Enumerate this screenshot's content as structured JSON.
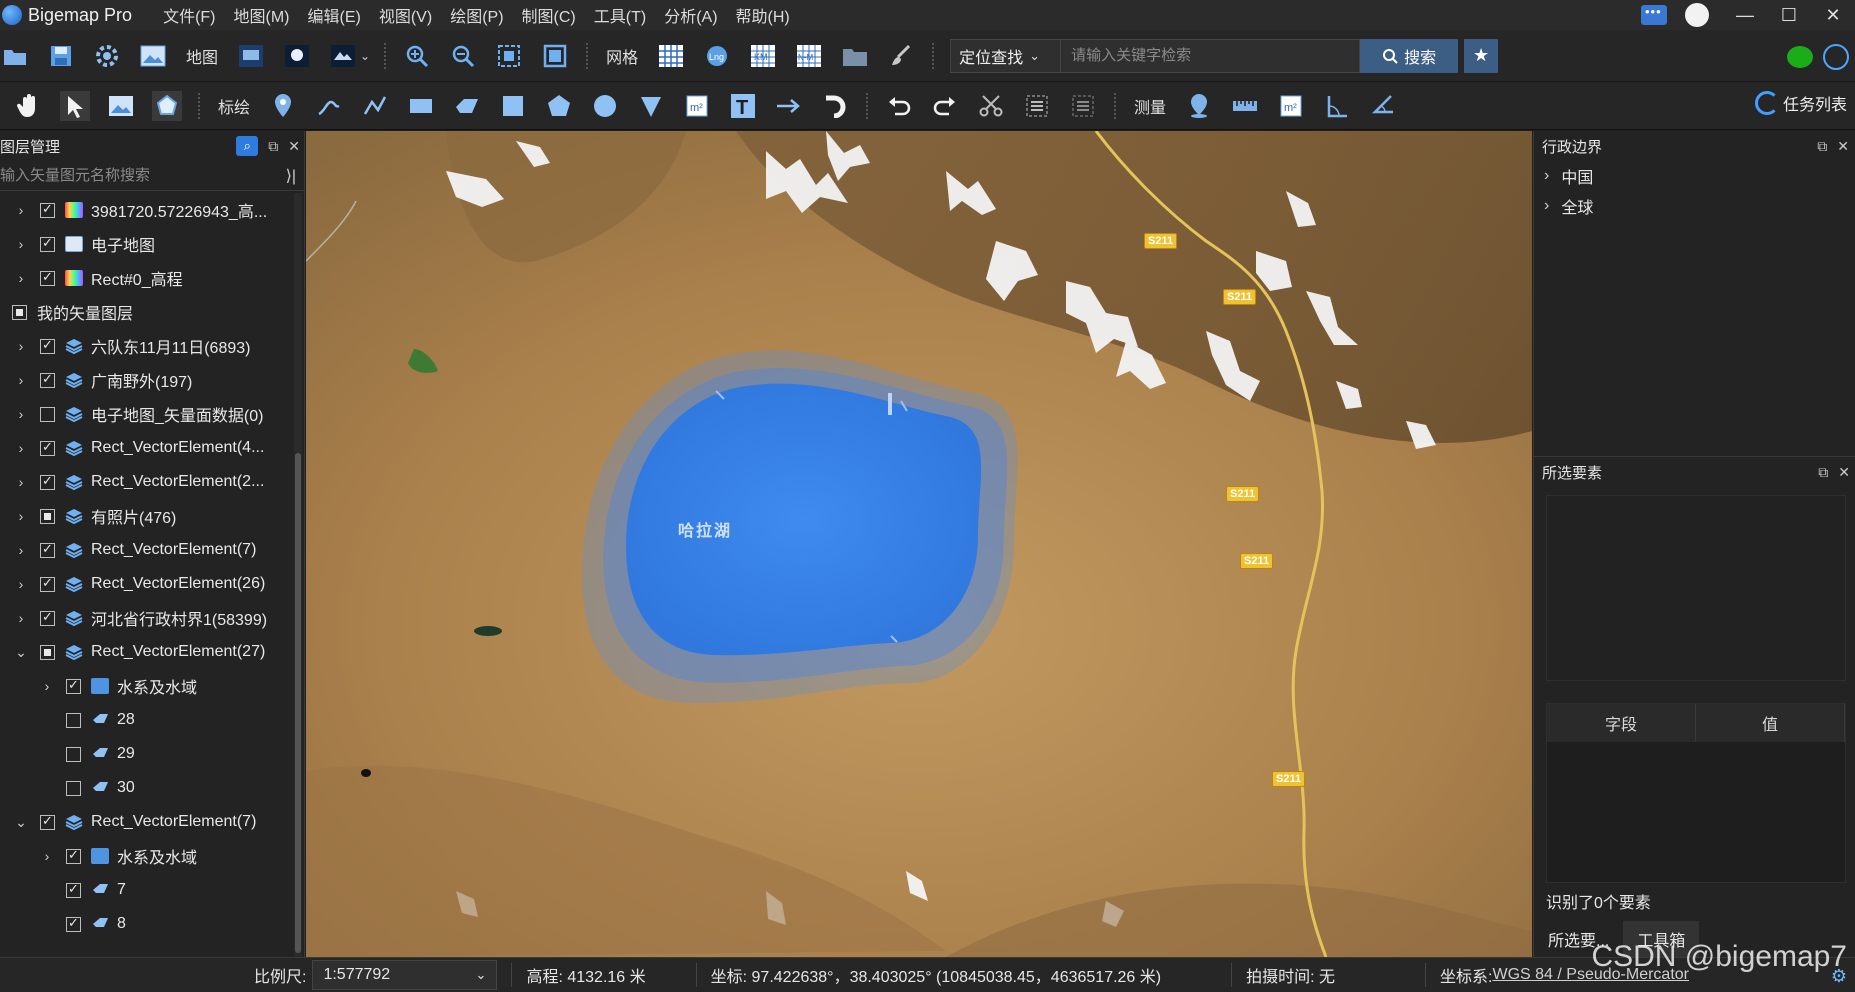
{
  "app": {
    "title": "Bigemap Pro"
  },
  "menu": [
    "文件(F)",
    "地图(M)",
    "编辑(E)",
    "视图(V)",
    "绘图(P)",
    "制图(C)",
    "工具(T)",
    "分析(A)",
    "帮助(H)"
  ],
  "toolbar1": {
    "map_label": "地图",
    "grid_label": "网格",
    "search_mode": "定位查找",
    "search_placeholder": "请输入关键字检索",
    "search_button": "搜索",
    "icon_lng": "Lng",
    "icon_km": "KM",
    "icon_nm": "N-M"
  },
  "toolbar2": {
    "draw_label": "标绘",
    "measure_label": "测量",
    "text_tool": "T",
    "area_unit": "m²",
    "task_list": "任务列表"
  },
  "left_panel": {
    "title": "图层管理",
    "search_placeholder": "输入矢量图元名称搜索",
    "rows": [
      {
        "label": "3981720.57226943_高...",
        "chev": "›",
        "check": "checked",
        "icon": "raster",
        "indent": 0
      },
      {
        "label": "电子地图",
        "chev": "›",
        "check": "checked",
        "icon": "map",
        "indent": 0
      },
      {
        "label": "Rect#0_高程",
        "chev": "›",
        "check": "checked",
        "icon": "raster",
        "indent": 0
      },
      {
        "label": "我的矢量图层",
        "chev": "",
        "check": "partial",
        "icon": "none",
        "indent": -1
      },
      {
        "label": "六队东11月11日(6893)",
        "chev": "›",
        "check": "checked",
        "icon": "layer",
        "indent": 0
      },
      {
        "label": "广南野外(197)",
        "chev": "›",
        "check": "checked",
        "icon": "layer",
        "indent": 0
      },
      {
        "label": "电子地图_矢量面数据(0)",
        "chev": "›",
        "check": "",
        "icon": "layer",
        "indent": 0
      },
      {
        "label": "Rect_VectorElement(4...",
        "chev": "›",
        "check": "checked",
        "icon": "layer",
        "indent": 0
      },
      {
        "label": "Rect_VectorElement(2...",
        "chev": "›",
        "check": "checked",
        "icon": "layer",
        "indent": 0
      },
      {
        "label": "有照片(476)",
        "chev": "›",
        "check": "partial",
        "icon": "layer",
        "indent": 0
      },
      {
        "label": "Rect_VectorElement(7)",
        "chev": "›",
        "check": "checked",
        "icon": "layer",
        "indent": 0
      },
      {
        "label": "Rect_VectorElement(26)",
        "chev": "›",
        "check": "checked",
        "icon": "layer",
        "indent": 0
      },
      {
        "label": "河北省行政村界1(58399)",
        "chev": "›",
        "check": "checked",
        "icon": "layer",
        "indent": 0
      },
      {
        "label": "Rect_VectorElement(27)",
        "chev": "⌄",
        "check": "partial",
        "icon": "layer",
        "indent": 0
      },
      {
        "label": "水系及水域",
        "chev": "›",
        "check": "checked",
        "icon": "folder",
        "indent": 1
      },
      {
        "label": "28",
        "chev": "",
        "check": "",
        "icon": "poly",
        "indent": 1
      },
      {
        "label": "29",
        "chev": "",
        "check": "",
        "icon": "poly",
        "indent": 1
      },
      {
        "label": "30",
        "chev": "",
        "check": "",
        "icon": "poly",
        "indent": 1
      },
      {
        "label": "Rect_VectorElement(7)",
        "chev": "⌄",
        "check": "checked",
        "icon": "layer",
        "indent": 0
      },
      {
        "label": "水系及水域",
        "chev": "›",
        "check": "checked",
        "icon": "folder",
        "indent": 1
      },
      {
        "label": "7",
        "chev": "",
        "check": "checked",
        "icon": "poly",
        "indent": 1
      },
      {
        "label": "8",
        "chev": "",
        "check": "checked",
        "icon": "poly",
        "indent": 1
      }
    ]
  },
  "map": {
    "lake_label": "哈拉湖",
    "road_label": "S211"
  },
  "right_panel": {
    "admin_title": "行政边界",
    "admin_items": [
      "中国",
      "全球"
    ],
    "selected_title": "所选要素",
    "field_header": "字段",
    "value_header": "值",
    "identified_text": "识别了0个要素",
    "tabs": [
      "所选要...",
      "工具箱"
    ]
  },
  "status": {
    "scale_label": "比例尺:",
    "scale_value": "1:577792",
    "elevation": "高程: 4132.16 米",
    "coords": "坐标: 97.422638°，38.403025°  (10845038.45，4636517.26 米)",
    "capture_time": "拍摄时间: 无",
    "crs_label": "坐标系:",
    "crs_value": "WGS 84 / Pseudo-Mercator"
  },
  "watermark": "CSDN @bigemap7",
  "colors": {
    "accent": "#2f7ce0",
    "lake": "#3d86e8",
    "button": "#3d5e84"
  }
}
